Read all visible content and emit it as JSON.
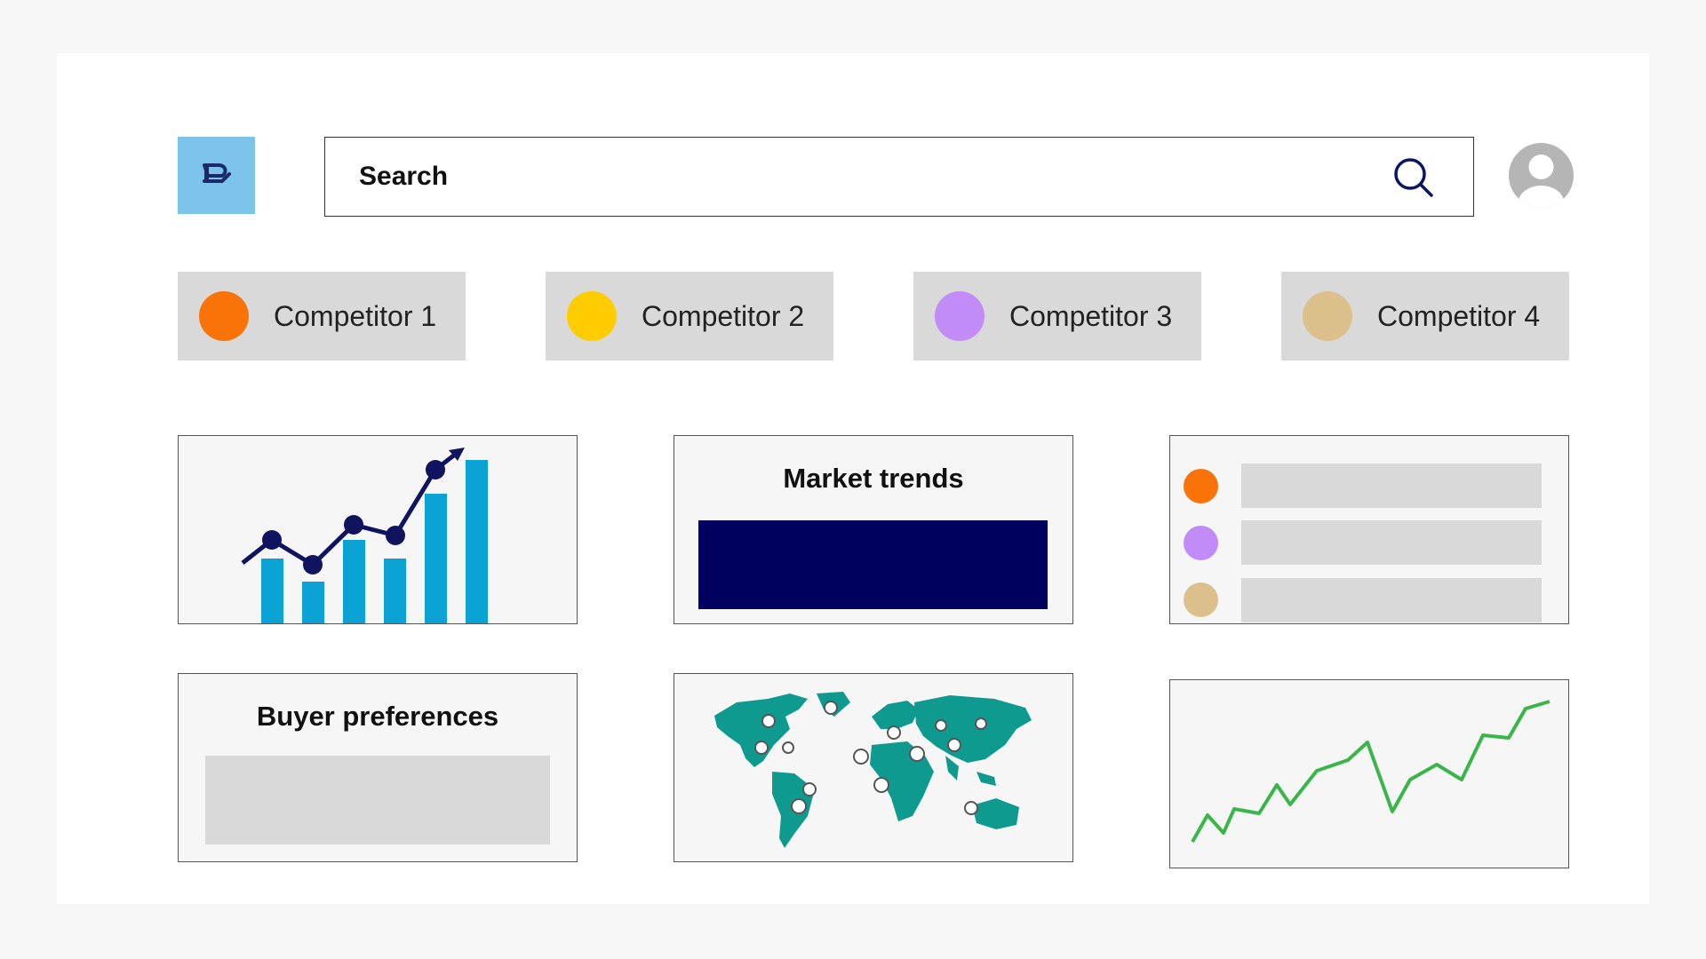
{
  "search": {
    "placeholder": "Search"
  },
  "competitors": [
    {
      "label": "Competitor 1",
      "color": "#f97309"
    },
    {
      "label": "Competitor 2",
      "color": "#ffcc00"
    },
    {
      "label": "Competitor 3",
      "color": "#c28cf8"
    },
    {
      "label": "Competitor 4",
      "color": "#dcc08c"
    }
  ],
  "panels": {
    "market_trends": {
      "title": "Market trends"
    },
    "buyer_preferences": {
      "title": "Buyer preferences"
    },
    "legend": {
      "colors": [
        "#f97309",
        "#c28cf8",
        "#dcc08c"
      ]
    }
  },
  "colors": {
    "brand": "#7cc4ec",
    "navy": "#00005e",
    "bar_blue": "#0ba2d6",
    "teal_map": "#0f9a8f",
    "green_line": "#3ab54a"
  },
  "icons": {
    "logo": "hand-bubble-icon",
    "search": "search-icon",
    "avatar": "user-avatar-icon"
  }
}
